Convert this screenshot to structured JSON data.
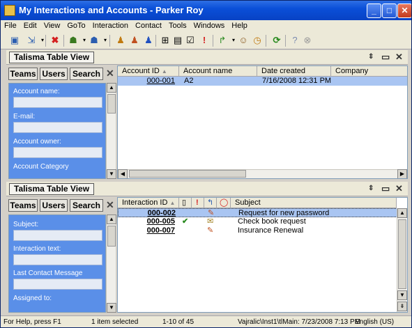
{
  "window": {
    "title": "My Interactions and Accounts - Parker Roy"
  },
  "menu": [
    "File",
    "Edit",
    "View",
    "GoTo",
    "Interaction",
    "Contact",
    "Tools",
    "Windows",
    "Help"
  ],
  "toolbar": {
    "icons": [
      "new-window-icon",
      "navigate-icon",
      "delete-icon",
      "contact-icon",
      "account-icon",
      "person-icon",
      "person-alt-icon",
      "person-blue-icon",
      "new-note-icon",
      "open-form-icon",
      "checklist-icon",
      "priority-icon",
      "forward-icon",
      "users-icon",
      "clock-icon",
      "refresh-icon",
      "help-icon",
      "cancel-icon"
    ]
  },
  "accounts_pane": {
    "title": "Talisma Table View",
    "filter_buttons": [
      "Teams",
      "Users",
      "Search"
    ],
    "fields": [
      "Account name:",
      "E-mail:",
      "Account owner:",
      "Account Category"
    ],
    "columns": [
      "Account ID",
      "Account name",
      "Date created",
      "Company"
    ],
    "rows": [
      {
        "id": "000-001",
        "name": "A2",
        "date": "7/16/2008 12:31 PM",
        "company": ""
      }
    ]
  },
  "interactions_pane": {
    "title": "Talisma Table View",
    "filter_buttons": [
      "Teams",
      "Users",
      "Search"
    ],
    "fields": [
      "Subject:",
      "Interaction text:",
      "Last Contact Message",
      "Assigned to:"
    ],
    "columns": [
      "Interaction ID",
      "Subject"
    ],
    "rows": [
      {
        "id": "000-002",
        "subject": "Request for new password",
        "done": false,
        "icon": "edit-icon"
      },
      {
        "id": "000-005",
        "subject": "Check book request",
        "done": true,
        "icon": "email-icon"
      },
      {
        "id": "000-007",
        "subject": "Insurance Renewal",
        "done": false,
        "icon": "edit-icon"
      }
    ]
  },
  "statusbar": {
    "help": "For Help, press F1",
    "selected": "1 item selected",
    "range": "1-10 of 45",
    "server": "Vajralic\\Inst1\\tlMain: 7/23/2008 7:13 PM",
    "locale": "English (US)"
  }
}
